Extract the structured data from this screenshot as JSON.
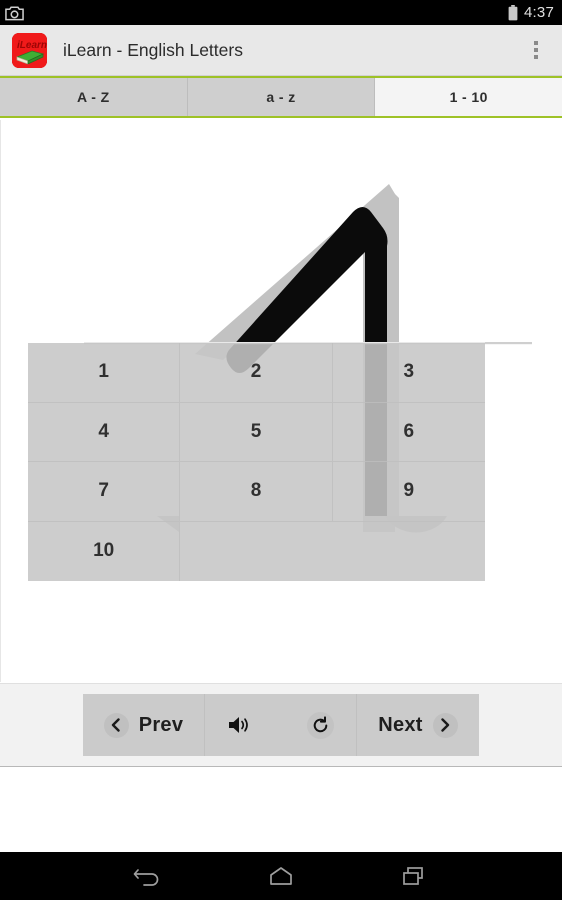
{
  "status_bar": {
    "left_icon": "camera-icon",
    "battery_icon": "battery-full-icon",
    "time": "4:37"
  },
  "action_bar": {
    "logo_icon": "ilearn-book-logo",
    "logo_text": "iLearn",
    "title": "iLearn - English Letters",
    "overflow_icon": "overflow-menu-icon"
  },
  "tabs": [
    {
      "label": "A - Z",
      "selected": false
    },
    {
      "label": "a - z",
      "selected": false
    },
    {
      "label": "1 - 10",
      "selected": true
    }
  ],
  "stage": {
    "glyph_name": "letter-a-stroke-guide",
    "glyph_stroke_color": "#000000",
    "glyph_guide_color": "#c2c2c2"
  },
  "number_grid": {
    "cells": [
      "1",
      "2",
      "3",
      "4",
      "5",
      "6",
      "7",
      "8",
      "9",
      "10"
    ]
  },
  "controls": {
    "prev_icon": "chevron-left-icon",
    "prev_label": "Prev",
    "speaker_icon": "speaker-volume-icon",
    "refresh_icon": "refresh-icon",
    "next_label": "Next",
    "next_icon": "chevron-right-icon"
  },
  "nav_bar": {
    "back_icon": "back-arrow-icon",
    "home_icon": "home-icon",
    "recents_icon": "recents-icon"
  },
  "colors": {
    "accent_green": "#9ec227",
    "logo_red": "#f01a1a",
    "logo_book_green": "#3faf35",
    "action_bar_bg": "#e8e8e8",
    "tab_bg": "#cfcfcf",
    "tab_selected_bg": "#f4f4f4",
    "control_bar_bg": "#cbcbcb",
    "footer_bg": "#f2f2f2"
  }
}
